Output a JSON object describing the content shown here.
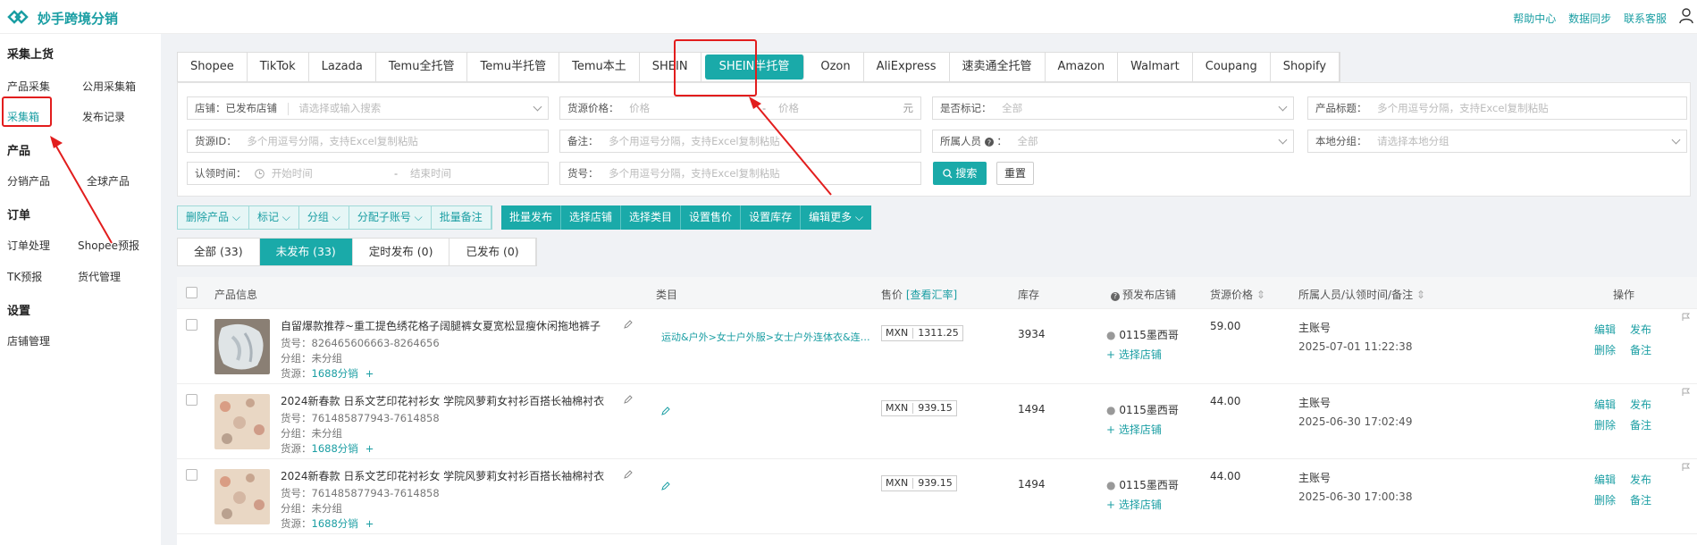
{
  "app": {
    "title": "妙手跨境分销",
    "links": [
      "帮助中心",
      "数据同步",
      "联系客服"
    ]
  },
  "sidebar": {
    "sections": [
      {
        "title": "采集上货",
        "items": [
          "产品采集",
          "公用采集箱",
          "采集箱",
          "发布记录"
        ]
      },
      {
        "title": "产品",
        "items": [
          "分销产品",
          "全球产品"
        ]
      },
      {
        "title": "订单",
        "items": [
          "订单处理",
          "Shopee预报",
          "TK预报",
          "货代管理"
        ]
      },
      {
        "title": "设置",
        "items": [
          "店铺管理"
        ]
      }
    ]
  },
  "platform_tabs": [
    "Shopee",
    "TikTok",
    "Lazada",
    "Temu全托管",
    "Temu半托管",
    "Temu本土",
    "SHEIN",
    "SHEIN半托管",
    "Ozon",
    "AliExpress",
    "速卖通全托管",
    "Amazon",
    "Walmart",
    "Coupang",
    "Shopify"
  ],
  "active_tab": "SHEIN半托管",
  "filters": {
    "store_label": "店铺：已发布店铺",
    "store_placeholder": "请选择或输入搜索",
    "price_label": "货源价格：",
    "price_min_ph": "价格",
    "price_sep": "-",
    "price_max_ph": "价格",
    "price_unit": "元",
    "marked_label": "是否标记：",
    "marked_value": "全部",
    "title_label": "产品标题：",
    "title_ph": "多个用逗号分隔，支持Excel复制粘贴",
    "srcid_label": "货源ID：",
    "srcid_ph": "多个用逗号分隔，支持Excel复制粘贴",
    "note_label": "备注：",
    "note_ph": "多个用逗号分隔，支持Excel复制粘贴",
    "owner_label": "所属人员",
    "owner_value": "全部",
    "group_label": "本地分组：",
    "group_ph": "请选择本地分组",
    "claim_label": "认领时间：",
    "claim_start": "开始时间",
    "claim_sep": "-",
    "claim_end": "结束时间",
    "sku_label": "货号：",
    "sku_ph": "多个用逗号分隔，支持Excel复制粘贴",
    "search": "搜索",
    "reset": "重置"
  },
  "actions_light": [
    "删除产品",
    "标记",
    "分组",
    "分配子账号",
    "批量备注"
  ],
  "actions_dark": [
    "批量发布",
    "选择店铺",
    "选择类目",
    "设置售价",
    "设置库存",
    "编辑更多"
  ],
  "status_tabs": [
    "全部 (33)",
    "未发布 (33)",
    "定时发布 (0)",
    "已发布 (0)"
  ],
  "columns": {
    "info": "产品信息",
    "category": "类目",
    "price": "售价",
    "rate": "[查看汇率]",
    "stock": "库存",
    "store": "预发布店铺",
    "src_price": "货源价格",
    "owner": "所属人员/认领时间/备注",
    "ops": "操作"
  },
  "rows": [
    {
      "title": "自留爆款推荐~重工提色绣花格子阔腿裤女夏宽松显瘦休闲拖地裤子",
      "sku": "货号：826465606663-8264656",
      "group": "分组：未分组",
      "src_label": "货源：",
      "src": "1688分销",
      "category": "运动&户外>女士户外服>女士户外连体衣&连…",
      "currency": "MXN",
      "price": "1311.25",
      "stock": "3934",
      "store": "0115墨西哥",
      "choose_store": "选择店铺",
      "src_price": "59.00",
      "owner": "主账号",
      "time": "2025-07-01 11:22:38"
    },
    {
      "title": "2024新春款 日系文艺印花衬衫女 学院风萝莉女衬衫百搭长袖棉衬衣",
      "sku": "货号：761485877943-7614858",
      "group": "分组：未分组",
      "src_label": "货源：",
      "src": "1688分销",
      "category": "",
      "currency": "MXN",
      "price": "939.15",
      "stock": "1494",
      "store": "0115墨西哥",
      "choose_store": "选择店铺",
      "src_price": "44.00",
      "owner": "主账号",
      "time": "2025-06-30 17:02:49"
    },
    {
      "title": "2024新春款 日系文艺印花衬衫女 学院风萝莉女衬衫百搭长袖棉衬衣",
      "sku": "货号：761485877943-7614858",
      "group": "分组：未分组",
      "src_label": "货源：",
      "src": "1688分销",
      "category": "",
      "currency": "MXN",
      "price": "939.15",
      "stock": "1494",
      "store": "0115墨西哥",
      "choose_store": "选择店铺",
      "src_price": "44.00",
      "owner": "主账号",
      "time": "2025-06-30 17:00:38"
    }
  ],
  "row_ops": [
    "编辑",
    "发布",
    "删除",
    "备注"
  ],
  "colors": {
    "accent": "#1aaaa9",
    "highlight": "#e21d1d"
  },
  "icons": [
    "logo-icon",
    "user-icon",
    "chevron-down-icon",
    "clock-icon",
    "search-icon",
    "pencil-icon",
    "plus-icon",
    "flag-icon",
    "sort-icon",
    "help-icon"
  ]
}
